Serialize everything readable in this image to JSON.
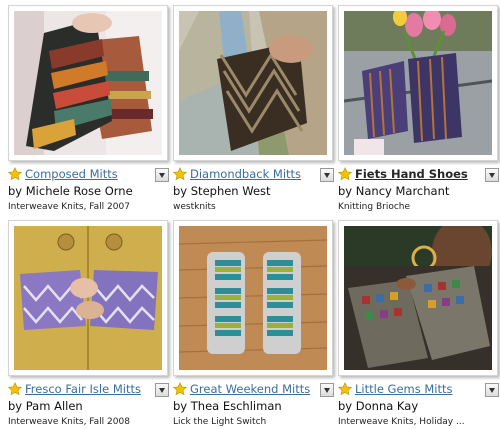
{
  "patterns": [
    {
      "title": "Composed Mitts",
      "author": "by Michele Rose Orne",
      "source": "Interweave Knits, Fall 2007",
      "highlighted": false
    },
    {
      "title": "Diamondback Mitts",
      "author": "by Stephen West",
      "source": "westknits",
      "highlighted": false
    },
    {
      "title": "Fiets Hand Shoes",
      "author": "by Nancy Marchant",
      "source": "Knitting Brioche",
      "highlighted": true
    },
    {
      "title": "Fresco Fair Isle Mitts",
      "author": "by Pam Allen",
      "source": "Interweave Knits, Fall 2008",
      "highlighted": false
    },
    {
      "title": "Great Weekend Mitts",
      "author": "by Thea Eschliman",
      "source": "Lick the Light Switch",
      "highlighted": false
    },
    {
      "title": "Little Gems Mitts",
      "author": "by Donna Kay",
      "source": "Interweave Knits, Holiday ...",
      "highlighted": false
    }
  ],
  "icons": {
    "favorite": "star-icon",
    "menu": "dropdown-arrow-icon"
  },
  "colors": {
    "link": "#3a6e9a",
    "star": "#f2c200"
  }
}
